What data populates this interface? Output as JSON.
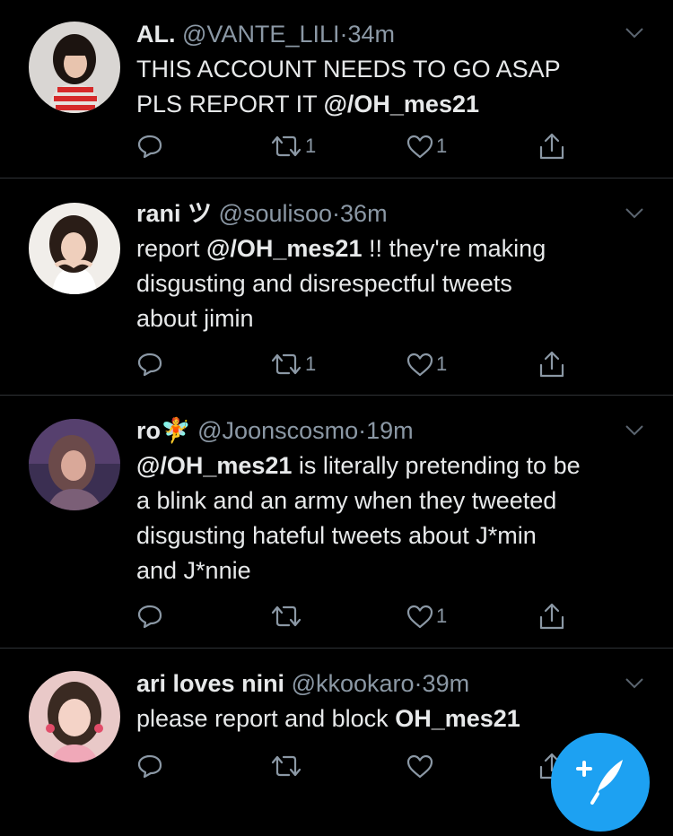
{
  "tweets": [
    {
      "name": "AL.",
      "handle": "@VANTE_LILI",
      "dot": "·",
      "time": "34m",
      "text_lines": [
        [
          {
            "t": "THIS ACCOUNT NEEDS TO GO ASAP"
          }
        ],
        [
          {
            "t": "PLS REPORT IT "
          },
          {
            "t": "@/OH_mes21",
            "b": true
          }
        ]
      ],
      "retweets": "1",
      "likes": "1"
    },
    {
      "name": "rani ツ",
      "handle": "@soulisoo",
      "dot": "·",
      "time": "36m",
      "text_lines": [
        [
          {
            "t": "report "
          },
          {
            "t": "@/OH_mes21",
            "b": true
          },
          {
            "t": " !! they're making"
          }
        ],
        [
          {
            "t": "disgusting and disrespectful tweets"
          }
        ],
        [
          {
            "t": "about jimin"
          }
        ]
      ],
      "retweets": "1",
      "likes": "1"
    },
    {
      "name": "ro🧚",
      "handle": "@Joonscosmo",
      "dot": "·",
      "time": "19m",
      "text_lines": [
        [
          {
            "t": "@/OH_mes21",
            "b": true
          },
          {
            "t": " is literally pretending to be"
          }
        ],
        [
          {
            "t": "a blink and an army when they tweeted"
          }
        ],
        [
          {
            "t": "disgusting hateful tweets about J*min"
          }
        ],
        [
          {
            "t": "and J*nnie"
          }
        ]
      ],
      "retweets": "",
      "likes": "1"
    },
    {
      "name": "ari loves nini",
      "handle": "@kkookaro",
      "dot": "·",
      "time": "39m",
      "text_lines": [
        [
          {
            "t": "please report and block "
          },
          {
            "t": "OH_mes21",
            "b": true
          }
        ]
      ],
      "retweets": "",
      "likes": ""
    }
  ],
  "icons": {
    "reply": "reply-icon",
    "retweet": "retweet-icon",
    "like": "heart-icon",
    "share": "share-icon",
    "caret": "chevron-down-icon",
    "compose": "compose-tweet-icon"
  },
  "colors": {
    "background": "#000000",
    "text": "#e7e9ea",
    "secondary": "#8b98a5",
    "divider": "#2f3336",
    "accent": "#1da1f2"
  }
}
